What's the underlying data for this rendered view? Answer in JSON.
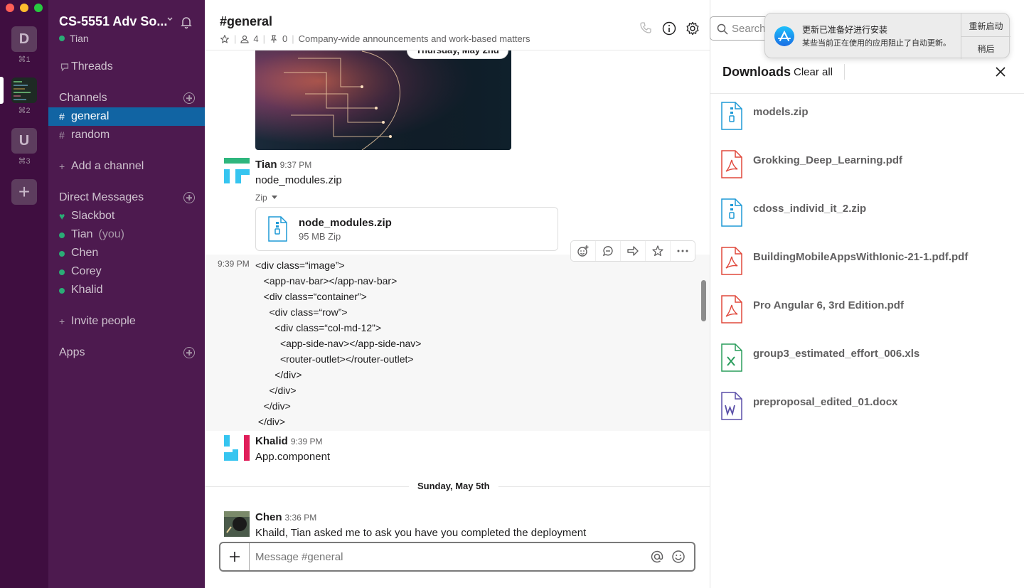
{
  "window": {
    "traffic_lights": [
      "#fe5f57",
      "#febc2e",
      "#28c840"
    ]
  },
  "rail": {
    "workspaces": [
      {
        "letter": "D",
        "shortcut": "⌘1"
      },
      {
        "letter": "",
        "shortcut": "⌘2"
      },
      {
        "letter": "U",
        "shortcut": "⌘3"
      }
    ],
    "add_label": "+"
  },
  "sidebar": {
    "team_name": "CS-5551 Adv So...",
    "current_user": "Tian",
    "threads_label": "Threads",
    "channels_heading": "Channels",
    "channels": [
      {
        "name": "general",
        "active": true
      },
      {
        "name": "random",
        "active": false
      }
    ],
    "add_channel_label": "Add a channel",
    "dm_heading": "Direct Messages",
    "dms": [
      {
        "name": "Slackbot",
        "suffix": ""
      },
      {
        "name": "Tian",
        "suffix": "(you)"
      },
      {
        "name": "Chen",
        "suffix": ""
      },
      {
        "name": "Corey",
        "suffix": ""
      },
      {
        "name": "Khalid",
        "suffix": ""
      }
    ],
    "invite_label": "Invite people",
    "apps_heading": "Apps"
  },
  "channel": {
    "name": "#general",
    "members": "4",
    "pins": "0",
    "topic": "Company-wide announcements and work-based matters"
  },
  "search": {
    "placeholder": "Search"
  },
  "messages": {
    "date1": "Thursday, May 2nd",
    "tian": {
      "user": "Tian",
      "time": "9:37 PM",
      "text": "node_modules.zip",
      "file_type_label": "Zip",
      "file_name": "node_modules.zip",
      "file_meta": "95 MB Zip"
    },
    "code_time": "9:39 PM",
    "code_lines": [
      "<div class=“image”>",
      "   <app-nav-bar></app-nav-bar>",
      "   <div class=“container”>",
      "     <div class=“row”>",
      "       <div class=“col-md-12”>",
      "         <app-side-nav></app-side-nav>",
      "         <router-outlet></router-outlet>",
      "       </div>",
      "     </div>",
      "   </div>",
      " </div>"
    ],
    "khalid": {
      "user": "Khalid",
      "time": "9:39 PM",
      "text": "App.component"
    },
    "date2": "Sunday, May 5th",
    "chen": {
      "user": "Chen",
      "time": "3:36 PM",
      "text": "Khaild, Tian asked me to ask you have you completed the deployment"
    }
  },
  "composer": {
    "placeholder": "Message #general"
  },
  "downloads": {
    "title": "Downloads",
    "clear_all": "Clear all",
    "files": [
      {
        "name": "models.zip",
        "kind": "zip"
      },
      {
        "name": "Grokking_Deep_Learning.pdf",
        "kind": "pdf"
      },
      {
        "name": "cdoss_individ_it_2.zip",
        "kind": "zip"
      },
      {
        "name": "BuildingMobileAppsWithIonic-21-1.pdf.pdf",
        "kind": "pdf"
      },
      {
        "name": "Pro Angular 6, 3rd Edition.pdf",
        "kind": "pdf"
      },
      {
        "name": "group3_estimated_effort_006.xls",
        "kind": "xls"
      },
      {
        "name": "preproposal_edited_01.docx",
        "kind": "docx"
      }
    ]
  },
  "notification": {
    "title": "更新已准备好进行安装",
    "body": "某些当前正在使用的应用阻止了自动更新。",
    "primary_button": "重新启动",
    "secondary_button": "稍后"
  }
}
